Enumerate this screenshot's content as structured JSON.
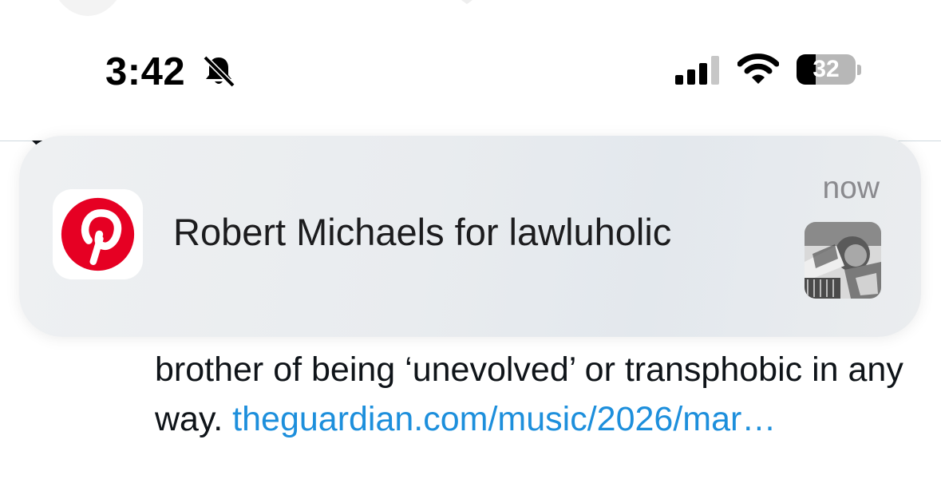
{
  "status_bar": {
    "time": "3:42",
    "battery_level": "32",
    "battery_fraction": 0.32,
    "icons": [
      "bell-slash-icon",
      "cellular-signal-icon",
      "wifi-icon",
      "battery-icon"
    ]
  },
  "notification": {
    "app_icon": "pinterest-icon",
    "title": "Robert Michaels for lawluholic",
    "time": "now",
    "thumbnail": "pin-thumbnail-image"
  },
  "tweet": {
    "text": "brother of being ‘unevolved’ or transphobic in any way. ",
    "link": "theguardian.com/music/2026/mar…"
  },
  "colors": {
    "pinterest_red": "#E60023",
    "link_blue": "#1D8FDC"
  }
}
